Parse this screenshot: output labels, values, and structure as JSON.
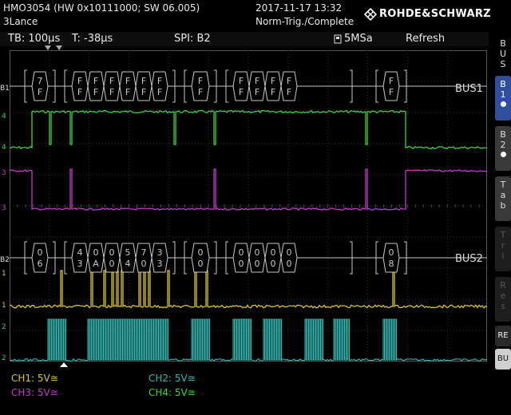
{
  "header": {
    "model": "HMO3054 (HW 0x10111000; SW 06.005)",
    "user": "3Lance",
    "datetime": "2017-11-17 13:32",
    "trigger_status": "Norm-Trig./Complete",
    "brand": "ROHDE&SCHWARZ"
  },
  "info_bar": {
    "timebase": "TB: 100µs",
    "trigger_time": "T: -38µs",
    "decode": "SPI: B2",
    "sample_rate": "5MSa",
    "mode": "Refresh"
  },
  "bus1": {
    "label": "BUS1",
    "marker": "B1",
    "bytes": [
      [
        "7",
        "F"
      ],
      [
        "F",
        "F"
      ],
      [
        "F",
        "F"
      ],
      [
        "F",
        "F"
      ],
      [
        "F",
        "F"
      ],
      [
        "F",
        "F"
      ],
      [
        "F",
        "F"
      ],
      [
        "F",
        "F"
      ],
      [
        "F",
        "F"
      ],
      [
        "F",
        "F"
      ],
      [
        "F",
        "F"
      ],
      [
        "F",
        "F"
      ],
      [
        "F",
        "F"
      ]
    ]
  },
  "bus2": {
    "label": "BUS2",
    "marker": "B2",
    "bytes": [
      [
        "0",
        "6"
      ],
      [
        "4",
        "3"
      ],
      [
        "0",
        "A"
      ],
      [
        "0",
        "0"
      ],
      [
        "5",
        "4"
      ],
      [
        "7",
        "0"
      ],
      [
        "3",
        "3"
      ],
      [
        "0",
        "0"
      ],
      [
        "0",
        "0"
      ],
      [
        "0",
        "0"
      ],
      [
        "0",
        "0"
      ],
      [
        "0",
        "0"
      ],
      [
        "0",
        "8"
      ]
    ]
  },
  "channel_markers": {
    "ch1": "1",
    "ch2": "2",
    "ch3": "3",
    "ch4": "4"
  },
  "channels": [
    {
      "label": "CH1: 5V≅",
      "color": "#d6c431"
    },
    {
      "label": "CH2: 5V≅",
      "color": "#34b6b0"
    },
    {
      "label": "CH3: 5V≅",
      "color": "#c03ac6"
    },
    {
      "label": "CH4: 5V≅",
      "color": "#3bd13b"
    }
  ],
  "sidebar": {
    "title": [
      "B",
      "U",
      "S"
    ],
    "b1": [
      "B",
      "1"
    ],
    "b2": [
      "B",
      "2"
    ],
    "tab": [
      "T",
      "a",
      "b"
    ],
    "dim1": [
      "T",
      "r",
      "i"
    ],
    "dim2": [
      "R",
      "e",
      "s"
    ],
    "re": "RE",
    "bu": "BU"
  },
  "colors": {
    "ch1": "#d6c431",
    "ch2": "#34b6b0",
    "ch3": "#c03ac6",
    "ch4": "#3bd13b",
    "grid": "#3a3a3a",
    "bus": "#c8c8c8",
    "active": "#2f4f9c"
  }
}
